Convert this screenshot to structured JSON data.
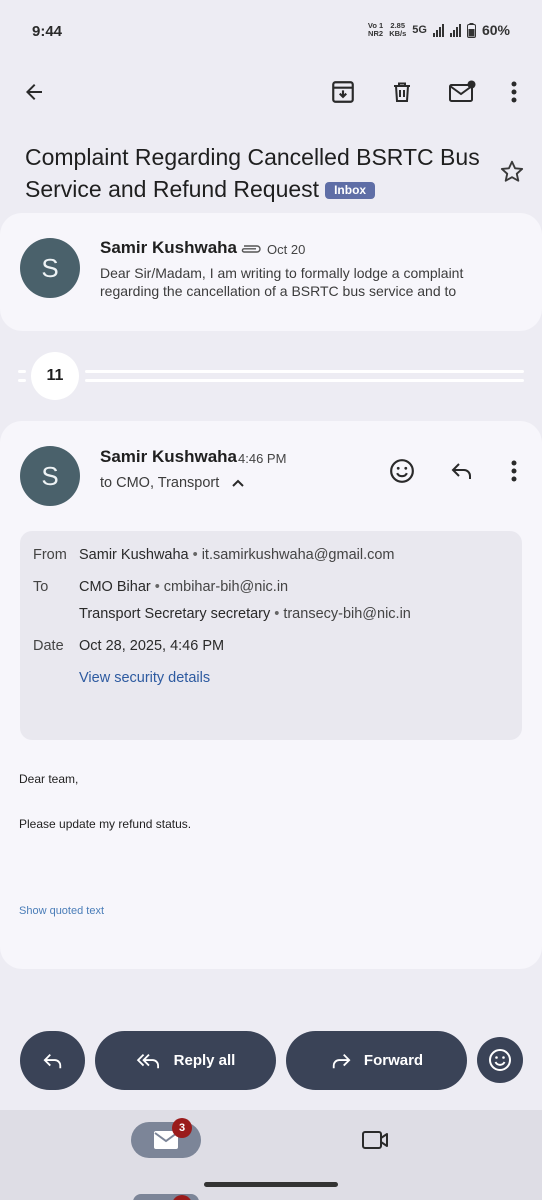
{
  "status_bar": {
    "time": "9:44",
    "volte_top": "Vo 1",
    "volte_bottom": "NR2",
    "speed_value": "2.85",
    "speed_unit": "KB/s",
    "network": "5G",
    "battery": "60%"
  },
  "thread": {
    "subject_line1": "Complaint Regarding Cancelled BSRTC Bus",
    "subject_line2": "Service and Refund Request",
    "label": "Inbox"
  },
  "first_message": {
    "avatar_letter": "S",
    "sender": "Samir Kushwaha",
    "date": "Oct 20",
    "snippet": "Dear Sir/Madam, I am writing to formally lodge a complaint regarding the cancellation of a BSRTC bus service and to"
  },
  "collapsed": {
    "count": "11"
  },
  "open_message": {
    "avatar_letter": "S",
    "sender": "Samir Kushwaha",
    "time": "4:46 PM",
    "recipients_summary": "to CMO, Transport",
    "details": {
      "from_label": "From",
      "from_name": "Samir Kushwaha",
      "from_email": "it.samirkushwaha@gmail.com",
      "to_label": "To",
      "to_1_name": "CMO Bihar",
      "to_1_email": "cmbihar-bih@nic.in",
      "to_2_name": "Transport Secretary secretary",
      "to_2_email": "transecy-bih@nic.in",
      "date_label": "Date",
      "date_value": "Oct 28, 2025, 4:46 PM",
      "security_link": "View security details"
    },
    "body_greeting": "Dear team,",
    "body_text": "Please update my refund status.",
    "quoted_link": "Show quoted text"
  },
  "actions": {
    "reply_all": "Reply all",
    "forward": "Forward"
  },
  "bottom_nav": {
    "mail_badge": "3"
  },
  "colors": {
    "accent_dark": "#3a4357",
    "avatar": "#4a616b",
    "chip": "#5f6ea6",
    "badge": "#9a1b1b",
    "link": "#2d5aa0"
  },
  "icons": [
    "back-arrow-icon",
    "archive-icon",
    "delete-icon",
    "mark-unread-icon",
    "more-vert-icon",
    "star-icon",
    "attachment-icon",
    "chevron-up-icon",
    "emoji-icon",
    "reply-icon",
    "reply-all-icon",
    "forward-icon",
    "mail-icon",
    "video-icon"
  ]
}
